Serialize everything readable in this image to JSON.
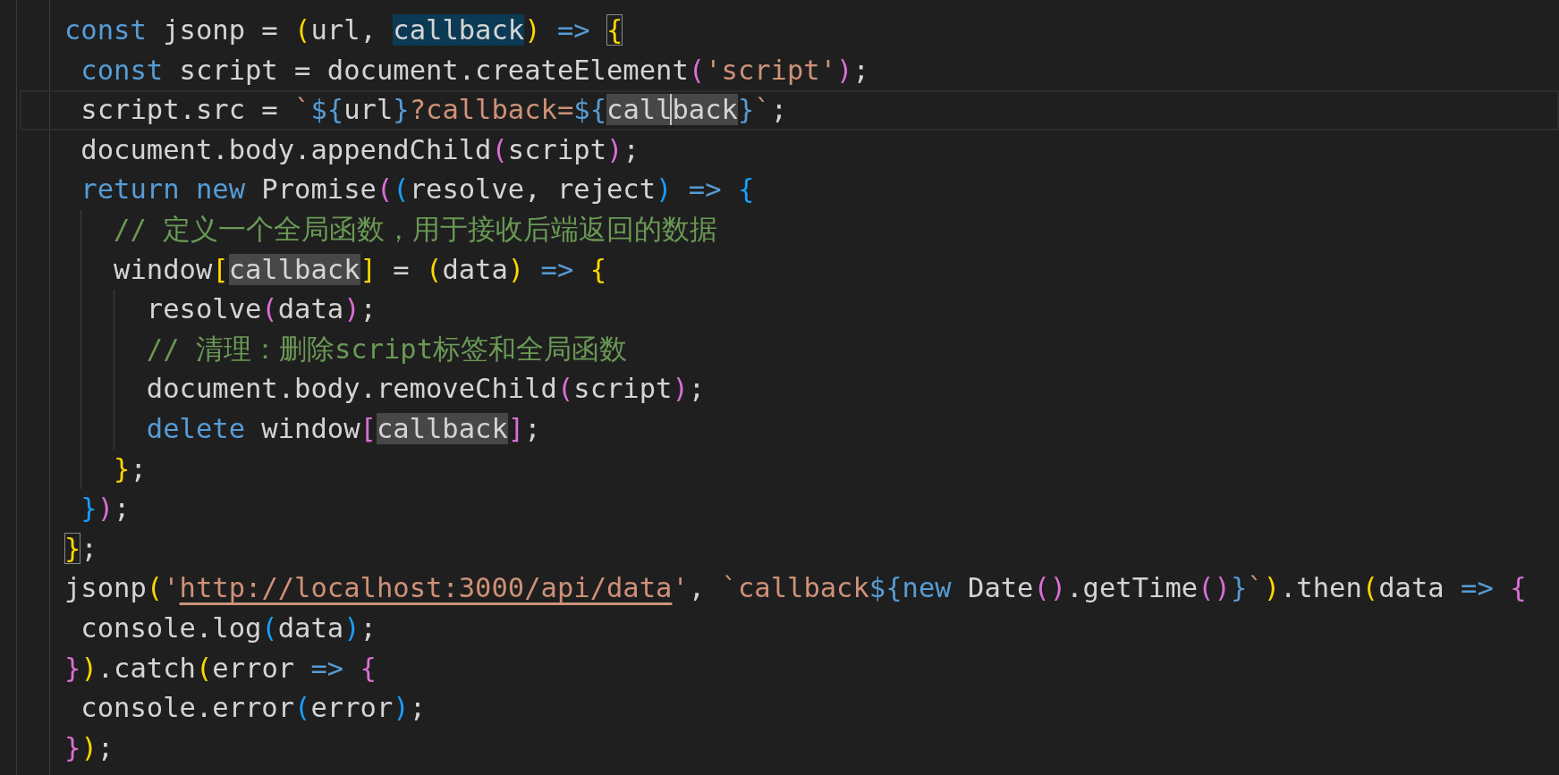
{
  "editor": {
    "lines": [
      {
        "current": false,
        "tokens": [
          {
            "text": "const",
            "kind": "keyword"
          },
          {
            "text": " jsonp = ",
            "kind": "plain"
          },
          {
            "text": "(",
            "kind": "bracket1"
          },
          {
            "text": "url, ",
            "kind": "plain"
          },
          {
            "text": "callback",
            "kind": "plain",
            "selection": true
          },
          {
            "text": ")",
            "kind": "bracket1"
          },
          {
            "text": " => ",
            "kind": "keyword"
          },
          {
            "text": "{",
            "kind": "bracket1",
            "match": true
          }
        ]
      },
      {
        "current": false,
        "tokens": [
          {
            "text": " const",
            "kind": "keyword"
          },
          {
            "text": " script = document.createElement",
            "kind": "plain"
          },
          {
            "text": "(",
            "kind": "bracket2"
          },
          {
            "text": "'script'",
            "kind": "string"
          },
          {
            "text": ")",
            "kind": "bracket2"
          },
          {
            "text": ";",
            "kind": "plain"
          }
        ]
      },
      {
        "current": true,
        "tokens": [
          {
            "text": " script.src = ",
            "kind": "plain"
          },
          {
            "text": "`",
            "kind": "string"
          },
          {
            "text": "${",
            "kind": "template"
          },
          {
            "text": "url",
            "kind": "plain"
          },
          {
            "text": "}",
            "kind": "template"
          },
          {
            "text": "?callback=",
            "kind": "string"
          },
          {
            "text": "${",
            "kind": "template"
          },
          {
            "text": "call",
            "kind": "plain",
            "occurrence": true,
            "cursor": true
          },
          {
            "text": "back",
            "kind": "plain",
            "occurrence": true
          },
          {
            "text": "}",
            "kind": "template"
          },
          {
            "text": "`",
            "kind": "string"
          },
          {
            "text": ";",
            "kind": "plain"
          }
        ]
      },
      {
        "current": false,
        "tokens": [
          {
            "text": " document.body.appendChild",
            "kind": "plain"
          },
          {
            "text": "(",
            "kind": "bracket2"
          },
          {
            "text": "script",
            "kind": "plain"
          },
          {
            "text": ")",
            "kind": "bracket2"
          },
          {
            "text": ";",
            "kind": "plain"
          }
        ]
      },
      {
        "current": false,
        "tokens": [
          {
            "text": " return new ",
            "kind": "keyword"
          },
          {
            "text": "Promise",
            "kind": "plain"
          },
          {
            "text": "(",
            "kind": "bracket2"
          },
          {
            "text": "(",
            "kind": "bracket3"
          },
          {
            "text": "resolve, reject",
            "kind": "plain"
          },
          {
            "text": ")",
            "kind": "bracket3"
          },
          {
            "text": " => ",
            "kind": "keyword"
          },
          {
            "text": "{",
            "kind": "bracket3"
          }
        ]
      },
      {
        "current": false,
        "tokens": [
          {
            "text": "   // 定义一个全局函数，用于接收后端返回的数据",
            "kind": "comment"
          }
        ]
      },
      {
        "current": false,
        "tokens": [
          {
            "text": "   window",
            "kind": "plain"
          },
          {
            "text": "[",
            "kind": "bracket1"
          },
          {
            "text": "callback",
            "kind": "plain",
            "occurrence": true
          },
          {
            "text": "]",
            "kind": "bracket1"
          },
          {
            "text": " = ",
            "kind": "plain"
          },
          {
            "text": "(",
            "kind": "bracket1"
          },
          {
            "text": "data",
            "kind": "plain"
          },
          {
            "text": ")",
            "kind": "bracket1"
          },
          {
            "text": " => ",
            "kind": "keyword"
          },
          {
            "text": "{",
            "kind": "bracket1"
          }
        ]
      },
      {
        "current": false,
        "tokens": [
          {
            "text": "     resolve",
            "kind": "plain"
          },
          {
            "text": "(",
            "kind": "bracket2"
          },
          {
            "text": "data",
            "kind": "plain"
          },
          {
            "text": ")",
            "kind": "bracket2"
          },
          {
            "text": ";",
            "kind": "plain"
          }
        ]
      },
      {
        "current": false,
        "tokens": [
          {
            "text": "     // 清理：删除script标签和全局函数",
            "kind": "comment"
          }
        ]
      },
      {
        "current": false,
        "tokens": [
          {
            "text": "     document.body.removeChild",
            "kind": "plain"
          },
          {
            "text": "(",
            "kind": "bracket2"
          },
          {
            "text": "script",
            "kind": "plain"
          },
          {
            "text": ")",
            "kind": "bracket2"
          },
          {
            "text": ";",
            "kind": "plain"
          }
        ]
      },
      {
        "current": false,
        "tokens": [
          {
            "text": "     delete",
            "kind": "keyword"
          },
          {
            "text": " window",
            "kind": "plain"
          },
          {
            "text": "[",
            "kind": "bracket2"
          },
          {
            "text": "callback",
            "kind": "plain",
            "occurrence": true
          },
          {
            "text": "]",
            "kind": "bracket2"
          },
          {
            "text": ";",
            "kind": "plain"
          }
        ]
      },
      {
        "current": false,
        "tokens": [
          {
            "text": "   }",
            "kind": "bracket1"
          },
          {
            "text": ";",
            "kind": "plain"
          }
        ]
      },
      {
        "current": false,
        "tokens": [
          {
            "text": " }",
            "kind": "bracket3"
          },
          {
            "text": ")",
            "kind": "bracket2"
          },
          {
            "text": ";",
            "kind": "plain"
          }
        ]
      },
      {
        "current": false,
        "tokens": [
          {
            "text": "}",
            "kind": "bracket1",
            "match": true
          },
          {
            "text": ";",
            "kind": "plain"
          }
        ]
      },
      {
        "current": false,
        "tokens": [
          {
            "text": "jsonp",
            "kind": "plain"
          },
          {
            "text": "(",
            "kind": "bracket1"
          },
          {
            "text": "'",
            "kind": "string"
          },
          {
            "text": "http://localhost:3000/api/data",
            "kind": "link"
          },
          {
            "text": "'",
            "kind": "string"
          },
          {
            "text": ", ",
            "kind": "plain"
          },
          {
            "text": "`callback",
            "kind": "string"
          },
          {
            "text": "${",
            "kind": "template"
          },
          {
            "text": "new",
            "kind": "keyword"
          },
          {
            "text": " Date",
            "kind": "plain"
          },
          {
            "text": "()",
            "kind": "bracket2"
          },
          {
            "text": ".getTime",
            "kind": "plain"
          },
          {
            "text": "()",
            "kind": "bracket2"
          },
          {
            "text": "}",
            "kind": "template"
          },
          {
            "text": "`",
            "kind": "string"
          },
          {
            "text": ")",
            "kind": "bracket1"
          },
          {
            "text": ".then",
            "kind": "plain"
          },
          {
            "text": "(",
            "kind": "bracket1"
          },
          {
            "text": "data ",
            "kind": "plain"
          },
          {
            "text": "=> ",
            "kind": "keyword"
          },
          {
            "text": "{",
            "kind": "bracket2"
          }
        ]
      },
      {
        "current": false,
        "tokens": [
          {
            "text": " console.log",
            "kind": "plain"
          },
          {
            "text": "(",
            "kind": "bracket3"
          },
          {
            "text": "data",
            "kind": "plain"
          },
          {
            "text": ")",
            "kind": "bracket3"
          },
          {
            "text": ";",
            "kind": "plain"
          }
        ]
      },
      {
        "current": false,
        "tokens": [
          {
            "text": "}",
            "kind": "bracket2"
          },
          {
            "text": ")",
            "kind": "bracket1"
          },
          {
            "text": ".catch",
            "kind": "plain"
          },
          {
            "text": "(",
            "kind": "bracket1"
          },
          {
            "text": "error ",
            "kind": "plain"
          },
          {
            "text": "=> ",
            "kind": "keyword"
          },
          {
            "text": "{",
            "kind": "bracket2"
          }
        ]
      },
      {
        "current": false,
        "tokens": [
          {
            "text": " console.error",
            "kind": "plain"
          },
          {
            "text": "(",
            "kind": "bracket3"
          },
          {
            "text": "error",
            "kind": "plain"
          },
          {
            "text": ")",
            "kind": "bracket3"
          },
          {
            "text": ";",
            "kind": "plain"
          }
        ]
      },
      {
        "current": false,
        "tokens": [
          {
            "text": "}",
            "kind": "bracket2"
          },
          {
            "text": ")",
            "kind": "bracket1"
          },
          {
            "text": ";",
            "kind": "plain"
          }
        ]
      }
    ]
  }
}
